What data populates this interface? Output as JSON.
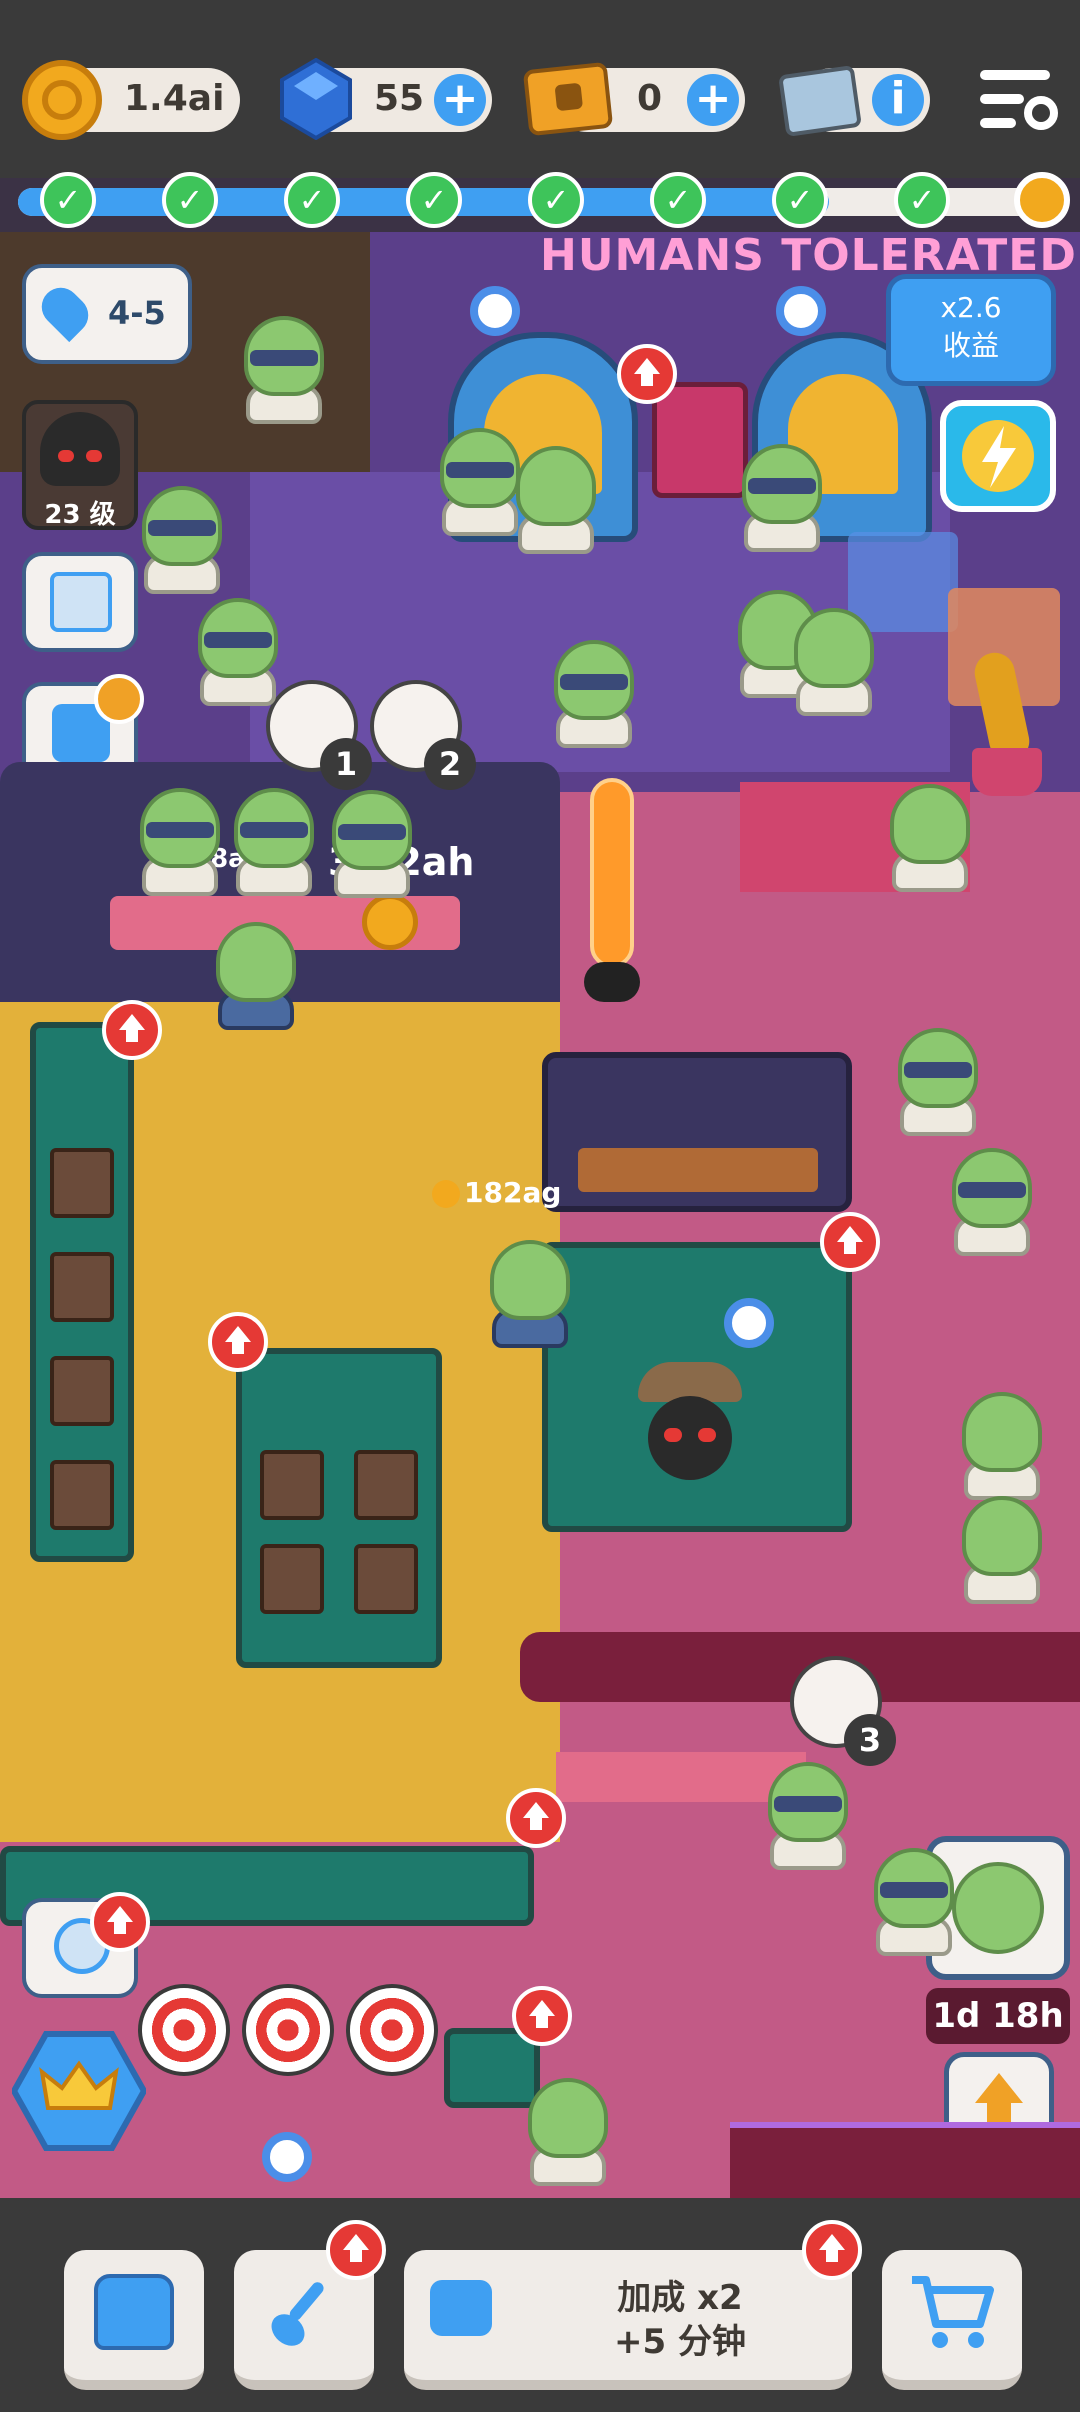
{
  "top": {
    "coins": "1.4ai",
    "gems": "55",
    "tickets": "0"
  },
  "progress": {
    "completed_steps": 8,
    "fraction": 0.78
  },
  "scene": {
    "sign": "HUMANS TOLERATED",
    "level_tag": "4-5",
    "player_level": "23 级",
    "multiplier_line1": "x2.6",
    "multiplier_line2": "收益",
    "order1_count": "1",
    "order2_count": "2",
    "order3_count": "3",
    "tip_small": "18ah",
    "counter_earnings": "31.2ah",
    "bar_earnings": "182ag",
    "event_timer": "1d 18h",
    "boost_count": "1"
  },
  "bottom": {
    "boost_line1": "加成 x2",
    "boost_line2": "+5 分钟"
  },
  "icons": {
    "coin": "coin-icon",
    "gem": "gem-icon",
    "ticket": "ticket-icon",
    "card": "card-icon",
    "menu": "settings-menu-icon",
    "location": "location-pin-icon",
    "calendar": "calendar-icon",
    "puzzle": "puzzle-icon",
    "clock": "clock-icon",
    "lightning": "lightning-icon",
    "crown": "crown-icon",
    "backpack": "backpack-icon",
    "shovel": "shovel-icon",
    "tv": "tv-icon",
    "cart": "cart-icon"
  },
  "colors": {
    "accent_blue": "#3f9ff2",
    "alert_red": "#e53935",
    "check_green": "#3ec45a",
    "floor_pink": "#c25a86"
  }
}
